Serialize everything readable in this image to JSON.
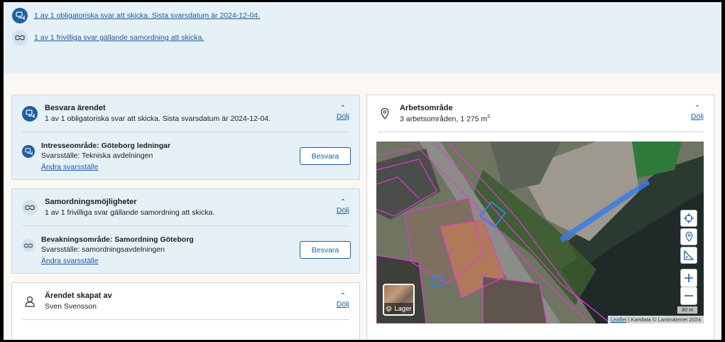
{
  "banner": {
    "notices": [
      {
        "icon": "chat-bubbles-icon",
        "text": "1 av 1 obligatoriska svar att skicka. Sista svarsdatum är 2024-12-04."
      },
      {
        "icon": "handshake-icon",
        "text": "1 av 1 frivilliga svar gällande samordning att skicka."
      }
    ]
  },
  "respond_card": {
    "title": "Besvara ärendet",
    "subtitle": "1 av 1 obligatoriska svar att skicka. Sista svarsdatum är 2024-12-04.",
    "toggle": "Dölj",
    "item": {
      "title": "Intresseområde: Göteborg ledningar",
      "subtitle": "Svarsställe: Tekniska avdelningen",
      "link": "Ändra svarsställe",
      "button": "Besvara"
    }
  },
  "coord_card": {
    "title": "Samordningsmöjligheter",
    "subtitle": "1 av 1 frivilliga svar gällande samordning att skicka.",
    "toggle": "Dölj",
    "item": {
      "title": "Bevakningsområde: Samordning Göteborg",
      "subtitle": "Svarsställe: samordningsavdelningen",
      "link": "Ändra svarsställe",
      "button": "Besvara"
    }
  },
  "creator_card": {
    "title": "Ärendet skapat av",
    "subtitle": "Sven Svensson",
    "toggle": "Dölj"
  },
  "work_area_card": {
    "title": "Arbetsområde",
    "subtitle_prefix": "3 arbetsområden, 1 275 m",
    "subtitle_sup": "2",
    "toggle": "Dölj"
  },
  "map": {
    "layer_button": "Lager",
    "scale_label": "30 m",
    "attribution_link": "Leaflet",
    "attribution_text": " | Kartdata © Lantmäteriet 2024",
    "controls": [
      "crosshair-icon",
      "map-pin-icon",
      "ruler-icon",
      "zoom-in-icon",
      "zoom-out-icon"
    ]
  },
  "colors": {
    "primary": "#1f5f9f",
    "link": "#1b5a9a",
    "card_bg": "#e6f0f7",
    "area_outline": "#e23ad8",
    "work_area": "#3a7de8"
  }
}
